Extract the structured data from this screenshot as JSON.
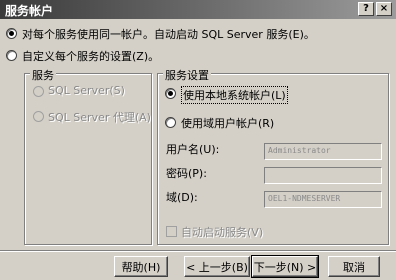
{
  "window": {
    "title": "服务帐户",
    "help_label": "?",
    "close_label": "×"
  },
  "options": {
    "same_account": "对每个服务使用同一帐户。自动启动 SQL Server 服务(E)。",
    "custom_per_service": "自定义每个服务的设置(Z)。"
  },
  "services_group": {
    "title": "服务",
    "items": [
      "SQL Server(S)",
      "SQL Server 代理(A)"
    ]
  },
  "settings_group": {
    "title": "服务设置",
    "local_system": "使用本地系统帐户(L)",
    "domain_user": "使用域用户帐户(R)",
    "username_label": "用户名(U):",
    "username_value": "Administrator",
    "password_label": "密码(P):",
    "password_value": "",
    "domain_label": "域(D):",
    "domain_value": "OEL1-NDMESERVER",
    "auto_start_label": "自动启动服务(V)"
  },
  "buttons": {
    "help": "帮助(H)",
    "back": "< 上一步(B)",
    "next": "下一步(N) >",
    "cancel": "取消"
  }
}
